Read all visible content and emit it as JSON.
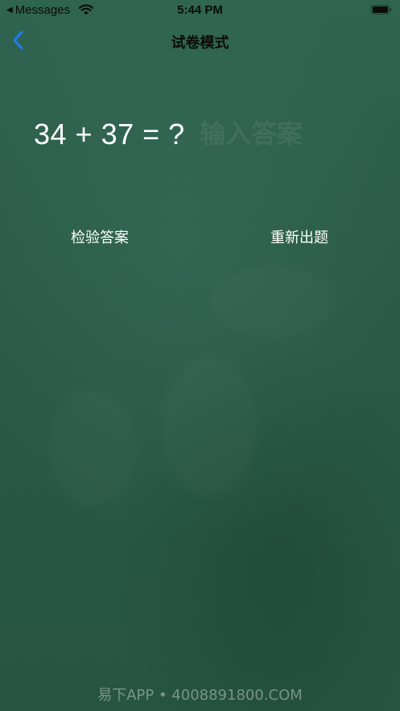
{
  "status_bar": {
    "back_app": "Messages",
    "back_arrow": "◀",
    "time": "5:44 PM",
    "icons": [
      "wifi-icon",
      "battery-icon"
    ]
  },
  "nav": {
    "title": "试卷模式",
    "back_icon": "chevron-left-icon",
    "accent_color": "#1e7cf2"
  },
  "quiz": {
    "question": "34 + 37 = ?",
    "answer_value": "",
    "answer_placeholder": "输入答案"
  },
  "actions": {
    "check_label": "检验答案",
    "refresh_label": "重新出题"
  },
  "watermark": "易下APP • 4008891800.COM",
  "colors": {
    "background": "#2b5a47",
    "text": "#ffffff"
  }
}
